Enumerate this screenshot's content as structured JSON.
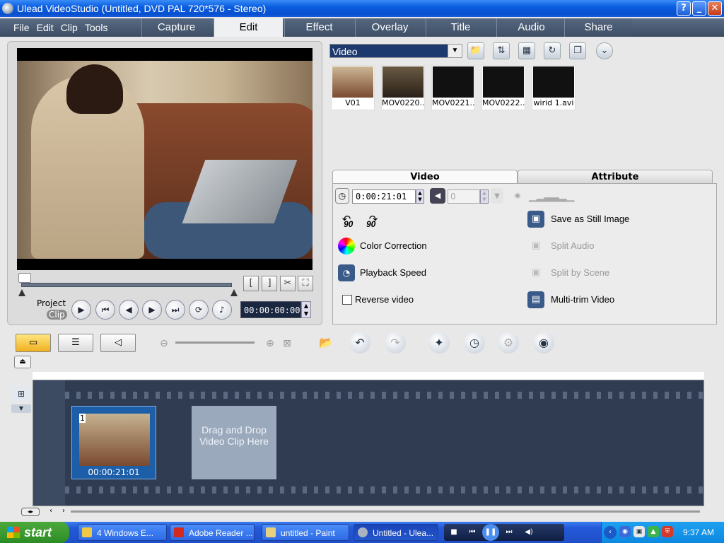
{
  "window": {
    "title": "Ulead VideoStudio (Untitled, DVD PAL 720*576 - Stereo)",
    "help_button": "?",
    "minimize_button": "_",
    "maximize_button": "□",
    "close_button": "✕"
  },
  "menu": [
    "File",
    "Edit",
    "Clip",
    "Tools"
  ],
  "steps": [
    "Capture",
    "Edit",
    "Effect",
    "Overlay",
    "Title",
    "Audio",
    "Share"
  ],
  "active_step": "Edit",
  "preview": {
    "mode_project": "Project",
    "mode_clip": "Clip",
    "timecode": "00:00:00:00",
    "mark_in": "[",
    "mark_out": "]"
  },
  "library": {
    "category": "Video",
    "thumbnails": [
      "V01",
      "MOV0220...",
      "MOV0221...",
      "MOV0222...",
      "wirid 1.avi"
    ]
  },
  "options": {
    "tabs": [
      "Video",
      "Attribute"
    ],
    "active_tab": "Video",
    "duration": "0:00:21:01",
    "volume": "0",
    "rotate_left": "90",
    "rotate_right": "90",
    "color_correction": "Color Correction",
    "playback_speed": "Playback Speed",
    "reverse_video": "Reverse video",
    "save_still": "Save as Still Image",
    "split_audio": "Split Audio",
    "split_scene": "Split by Scene",
    "multi_trim": "Multi-trim Video"
  },
  "timeline": {
    "clip_number": "1",
    "clip_timecode": "00:00:21:01",
    "drop_text": "Drag and Drop Video Clip Here"
  },
  "taskbar": {
    "start": "start",
    "items": [
      "4 Windows E...",
      "Adobe Reader ...",
      "untitled - Paint",
      "Untitled - Ulea..."
    ],
    "clock": "9:37 AM"
  },
  "colors": {
    "titlebar": "#0a5ee0",
    "step_bar": "#4a5a72",
    "timeline_bg": "#303c52",
    "clip_selected": "#1c5ea8"
  }
}
